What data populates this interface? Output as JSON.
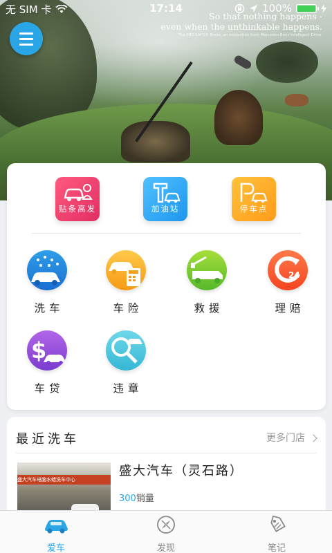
{
  "status_bar": {
    "carrier": "无 SIM 卡",
    "time": "17:14",
    "battery": "100%",
    "battery_level": 1.0
  },
  "banner": {
    "slogan_line1": "So that nothing happens -",
    "slogan_line2": "even when the unthinkable happens.",
    "slogan_small": "The PRE-SAFE® Brake, an innovation from Mercedes-Benz Intelligent Drive."
  },
  "menu": {
    "icon": "hamburger-menu-icon"
  },
  "top_services": [
    {
      "label": "贴条高发",
      "icon": "ticket-car-icon",
      "color": "#e83a6a"
    },
    {
      "label": "加油站",
      "icon": "gas-station-icon",
      "color": "#2aa6ef"
    },
    {
      "label": "停车点",
      "icon": "parking-icon",
      "color": "#ffa524"
    }
  ],
  "services": [
    {
      "label": "洗车",
      "icon": "car-wash-icon"
    },
    {
      "label": "车险",
      "icon": "car-insurance-icon"
    },
    {
      "label": "救援",
      "icon": "tow-truck-icon"
    },
    {
      "label": "理赔",
      "icon": "claims-24h-icon"
    },
    {
      "label": "车贷",
      "icon": "car-loan-icon"
    },
    {
      "label": "违章",
      "icon": "violation-search-icon"
    }
  ],
  "recent_wash": {
    "title": "最近洗车",
    "more_label": "更多门店",
    "shop": {
      "name": "盛大汽车（灵石路）",
      "sales_count": "300",
      "sales_suffix": "销量",
      "photo_sign": "盛大汽车电脑水蜡洗车中心"
    }
  },
  "tabs": [
    {
      "label": "爱车",
      "icon": "car-icon",
      "active": true
    },
    {
      "label": "发现",
      "icon": "compass-icon",
      "active": false
    },
    {
      "label": "笔记",
      "icon": "tag-icon",
      "active": false
    }
  ],
  "colors": {
    "accent": "#2aa6e6"
  }
}
